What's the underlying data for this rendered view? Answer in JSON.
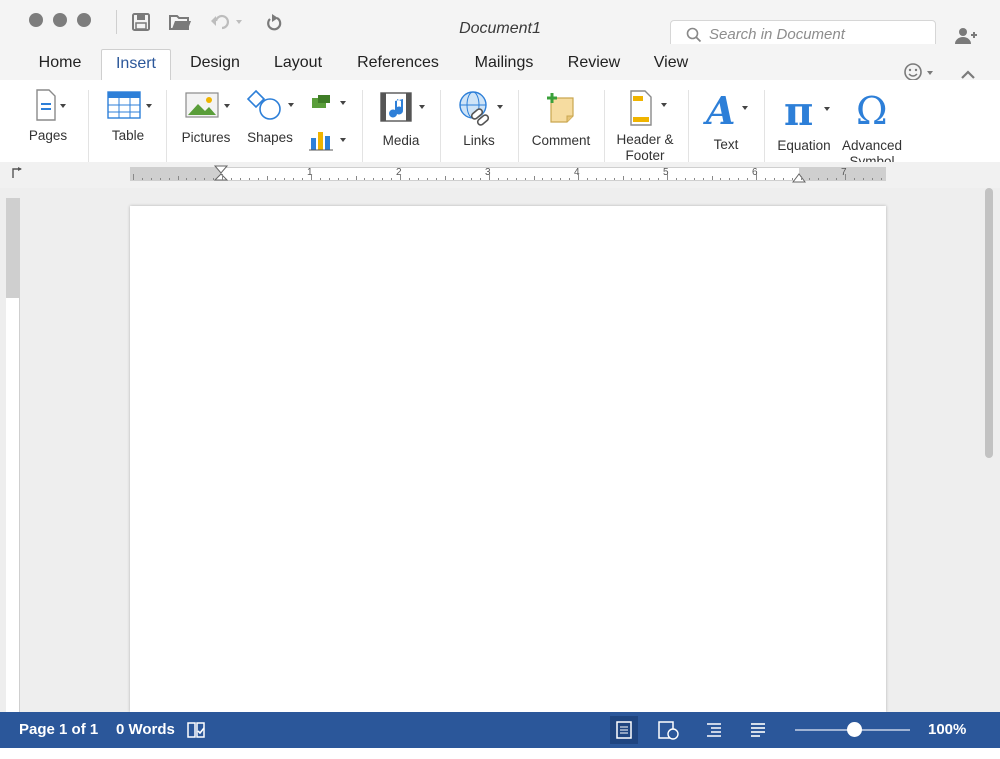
{
  "window": {
    "title": "Document1",
    "search_placeholder": "Search in Document"
  },
  "tabs": [
    {
      "label": "Home"
    },
    {
      "label": "Insert"
    },
    {
      "label": "Design"
    },
    {
      "label": "Layout"
    },
    {
      "label": "References"
    },
    {
      "label": "Mailings"
    },
    {
      "label": "Review"
    },
    {
      "label": "View"
    }
  ],
  "active_tab": "Insert",
  "ribbon": {
    "pages": "Pages",
    "table": "Table",
    "pictures": "Pictures",
    "shapes": "Shapes",
    "media": "Media",
    "links": "Links",
    "comment": "Comment",
    "header_footer_line1": "Header &",
    "header_footer_line2": "Footer",
    "text": "Text",
    "equation": "Equation",
    "advanced_symbol_line1": "Advanced",
    "advanced_symbol_line2": "Symbol"
  },
  "ruler": {
    "numbers": [
      "1",
      "2",
      "3",
      "4",
      "5",
      "6",
      "7"
    ]
  },
  "status": {
    "page": "Page 1 of 1",
    "words": "0 Words",
    "zoom": "100%",
    "zoom_level": 1.0
  },
  "colors": {
    "accent": "#2b579a",
    "status_bar": "#2b579a",
    "ribbon_blue": "#2d7fd8"
  }
}
